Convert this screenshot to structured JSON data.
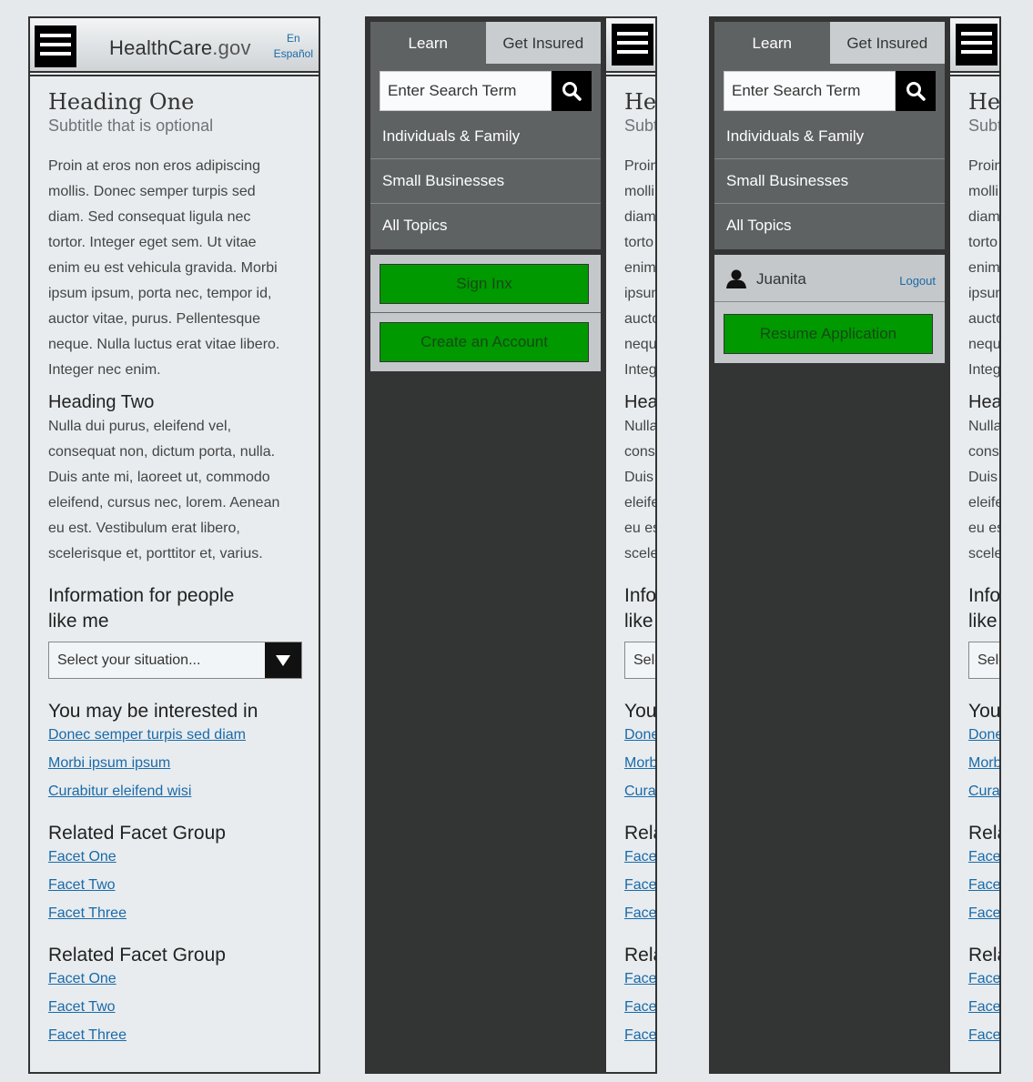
{
  "header": {
    "logo_main": "HealthCare",
    "logo_suffix": ".gov",
    "lang_en": "En",
    "lang_es": "Español"
  },
  "page": {
    "heading_one": "Heading One",
    "subtitle": "Subtitle that is optional",
    "para1_lines": [
      "Proin at eros non eros adipiscing",
      "mollis. Donec semper turpis sed",
      "diam. Sed consequat ligula nec",
      "tortor. Integer eget sem. Ut vitae",
      "enim eu est vehicula gravida. Morbi",
      "ipsum ipsum, porta nec, tempor id,",
      "auctor vitae, purus. Pellentesque",
      "neque. Nulla luctus erat vitae libero.",
      "Integer nec enim."
    ],
    "heading_two": "Heading Two",
    "para2_lines": [
      "Nulla dui purus, eleifend vel,",
      "consequat non, dictum porta, nulla.",
      "Duis ante mi, laoreet ut, commodo",
      "eleifend, cursus nec, lorem. Aenean",
      "eu est. Vestibulum erat libero,",
      "scelerisque et, porttitor et, varius."
    ],
    "info_heading_line1": "Information for people",
    "info_heading_line2": "like me",
    "select_placeholder": "Select your situation...",
    "interested_heading": "You may be interested in",
    "interested_links": [
      "Donec semper turpis sed diam",
      "Morbi ipsum ipsum",
      "Curabitur eleifend wisi"
    ],
    "facet_group_1": {
      "heading": "Related Facet Group",
      "links": [
        "Facet One",
        "Facet Two",
        "Facet Three"
      ]
    },
    "facet_group_2": {
      "heading": "Related Facet Group",
      "links": [
        "Facet One",
        "Facet Two",
        "Facet Three"
      ]
    }
  },
  "peek": {
    "heading_one": "Hea",
    "subtitle": "Subt",
    "para1_lines": [
      "Proin",
      "molli",
      "diam",
      "torto",
      "enim",
      "ipsum",
      "aucto",
      "nequ",
      "Integ"
    ],
    "heading_two": "Hea",
    "para2_lines": [
      "Nulla",
      "cons",
      "Duis",
      "eleife",
      "eu es",
      "scele"
    ],
    "info1": "Info",
    "info2": "like",
    "select": "Sele",
    "interested": "You",
    "links": [
      "Donec",
      "Morb",
      "Cura"
    ],
    "facet_heading": "Rela",
    "facet_links": [
      "Face",
      "Face",
      "Face"
    ]
  },
  "drawer": {
    "tab_learn": "Learn",
    "tab_get_insured": "Get Insured",
    "search_placeholder": "Enter Search Term",
    "nav_items": [
      "Individuals & Family",
      "Small Businesses",
      "All Topics"
    ],
    "sign_in_label": "Sign Inx",
    "create_account_label": "Create an Account",
    "user_name": "Juanita",
    "logout_label": "Logout",
    "resume_label": "Resume Application"
  },
  "colors": {
    "accent_green": "#009900",
    "link_blue": "#1a6aa8",
    "drawer_dark": "#5f6263"
  }
}
